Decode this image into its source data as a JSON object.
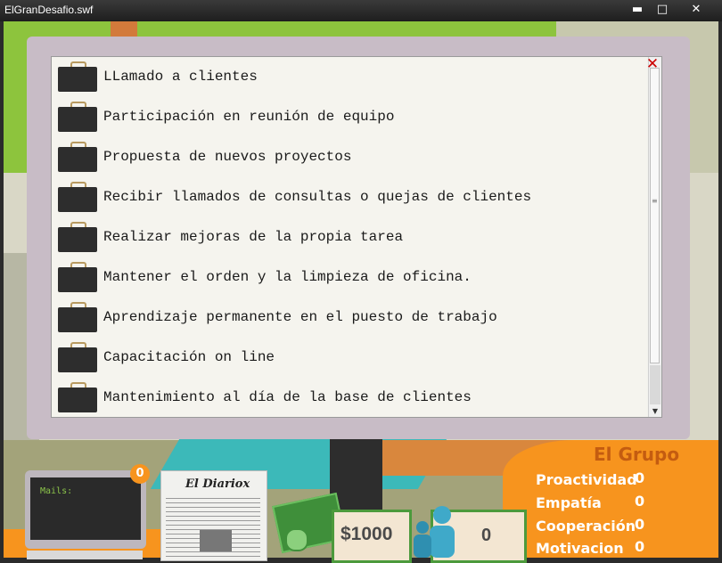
{
  "window": {
    "title": "ElGranDesafio.swf",
    "min_glyph": "▬",
    "max_glyph": "□",
    "close_glyph": "✕"
  },
  "tasks": {
    "items": [
      {
        "label": "LLamado a clientes",
        "icon": "briefcase-icon"
      },
      {
        "label": "Participación en reunión de equipo",
        "icon": "briefcase-icon"
      },
      {
        "label": "Propuesta de nuevos proyectos",
        "icon": "briefcase-icon"
      },
      {
        "label": "Recibir llamados de consultas o quejas de clientes",
        "icon": "briefcase-icon"
      },
      {
        "label": "Realizar mejoras de la propia tarea",
        "icon": "briefcase-icon"
      },
      {
        "label": "Mantener el orden y la limpieza de oficina.",
        "icon": "briefcase-icon"
      },
      {
        "label": "Aprendizaje permanente en el puesto de trabajo",
        "icon": "briefcase-icon"
      },
      {
        "label": "Capacitación on line",
        "icon": "briefcase-icon"
      },
      {
        "label": "Mantenimiento al día de la base de clientes",
        "icon": "briefcase-icon"
      }
    ],
    "close_glyph": "✕"
  },
  "hud": {
    "mails_label": "Mails:",
    "mail_count": "0",
    "newspaper_title": "El Diariox",
    "money": "$1000",
    "people_count": "0"
  },
  "group": {
    "title": "El Grupo",
    "stats": [
      {
        "name": "Proactividad",
        "value": "0"
      },
      {
        "name": "Empatía",
        "value": "0"
      },
      {
        "name": "Cooperación",
        "value": "0"
      },
      {
        "name": "Motivacion",
        "value": "0"
      }
    ]
  },
  "colors": {
    "accent_orange": "#f7941e",
    "money_green": "#4c9a3c",
    "close_red": "#cc0000"
  }
}
